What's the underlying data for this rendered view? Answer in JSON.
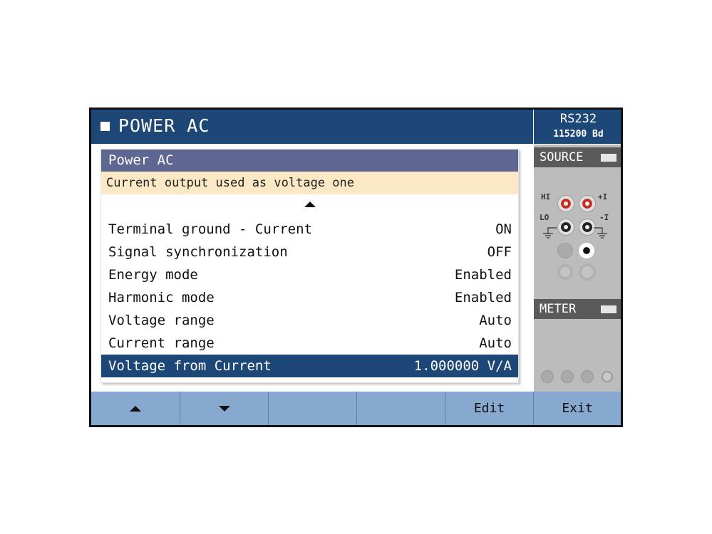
{
  "header": {
    "title": "POWER AC"
  },
  "interface": {
    "name": "RS232",
    "baud": "115200 Bd"
  },
  "panel": {
    "title": "Power AC",
    "info": "Current output used as voltage one",
    "rows": [
      {
        "label": "Terminal ground - Current",
        "value": "ON"
      },
      {
        "label": "Signal synchronization",
        "value": "OFF"
      },
      {
        "label": "Energy mode",
        "value": "Enabled"
      },
      {
        "label": "Harmonic mode",
        "value": "Enabled"
      },
      {
        "label": "Voltage range",
        "value": "Auto"
      },
      {
        "label": "Current range",
        "value": "Auto"
      },
      {
        "label": "Voltage from Current",
        "value": "1.000000 V/A",
        "selected": true
      }
    ]
  },
  "side": {
    "source_label": "SOURCE",
    "meter_label": "METER",
    "terminal_labels": {
      "hi": "HI",
      "lo": "LO",
      "plus_i": "+I",
      "minus_i": "-I"
    }
  },
  "softkeys": [
    {
      "icon": "arrow-up-icon",
      "label": ""
    },
    {
      "icon": "arrow-down-icon",
      "label": ""
    },
    {
      "icon": "",
      "label": ""
    },
    {
      "icon": "",
      "label": ""
    },
    {
      "icon": "",
      "label": "Edit"
    },
    {
      "icon": "",
      "label": "Exit"
    }
  ],
  "colors": {
    "title_bar": "#1d4776",
    "panel_header": "#5d6791",
    "info_bar": "#fbe9c6",
    "selected_row": "#1d4776",
    "softkey_bar": "#87a9cf",
    "side_panel": "#bcbcbc"
  }
}
